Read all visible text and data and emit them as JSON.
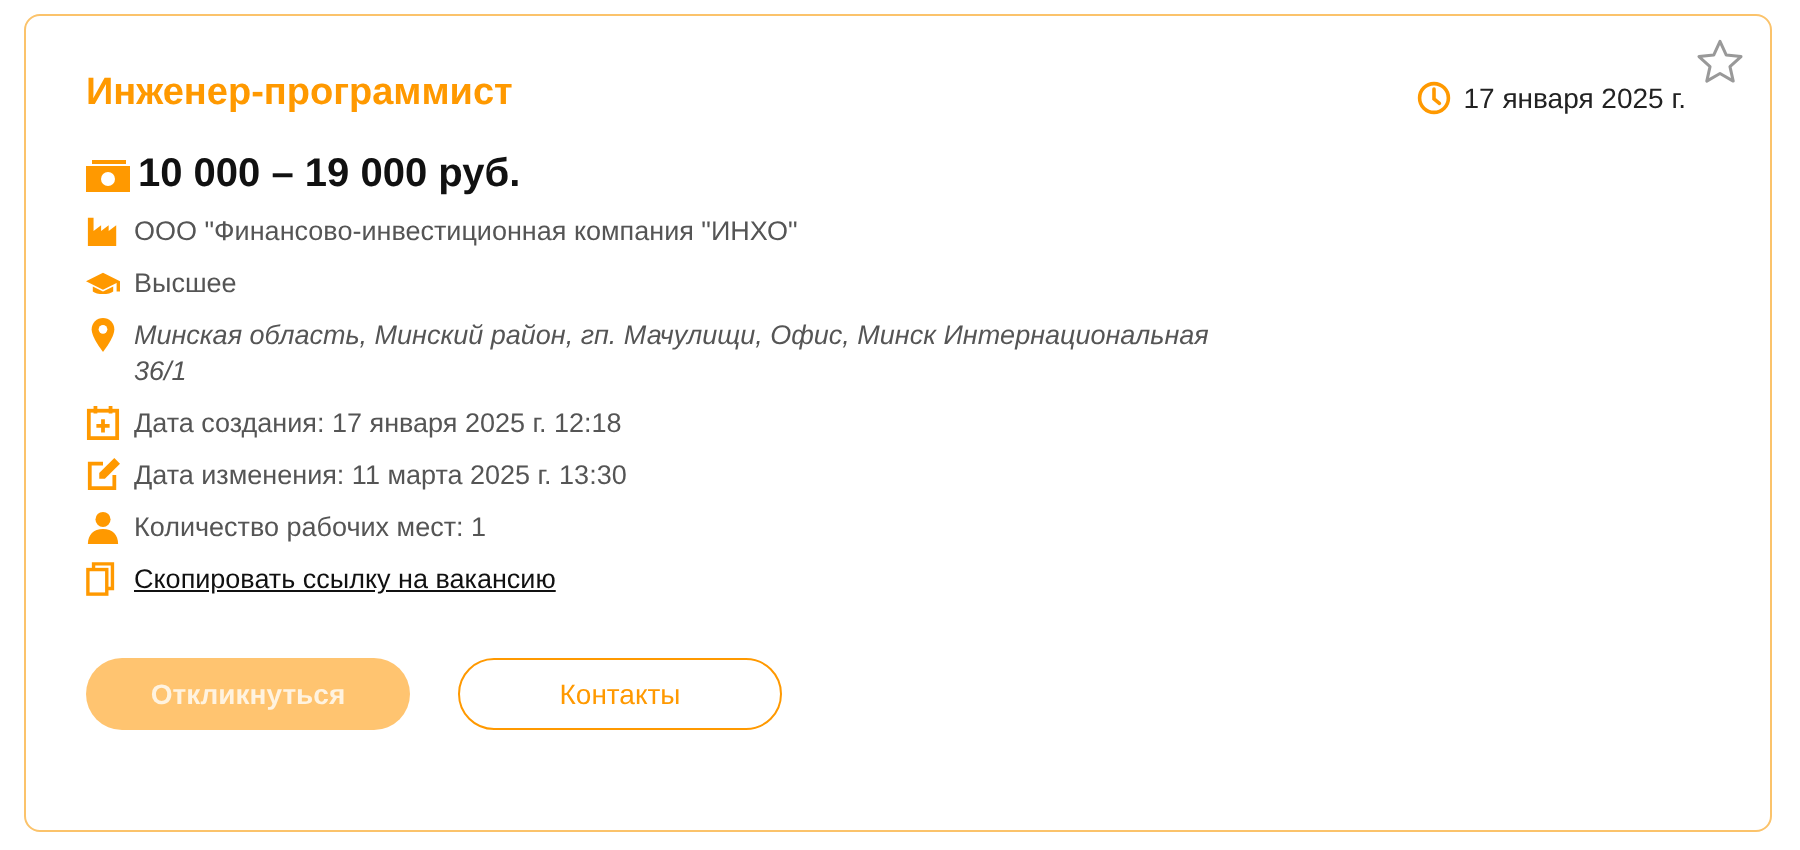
{
  "vacancy": {
    "title": "Инженер-программист",
    "date": "17 января 2025 г.",
    "favorite": false,
    "salary": "10 000 – 19 000 руб.",
    "details": [
      {
        "kind": "company",
        "text": "ООО \"Финансово-инвестиционная компания \"ИНХО\""
      },
      {
        "kind": "education",
        "text": "Высшее"
      },
      {
        "kind": "address",
        "text": "Минская область, Минский район, гп. Мачулищи, Офис, Минск Интернациональная 36/1"
      },
      {
        "kind": "created",
        "text": "Дата создания: 17 января 2025 г. 12:18"
      },
      {
        "kind": "modified",
        "text": "Дата изменения: 11 марта 2025 г. 13:30"
      },
      {
        "kind": "workplaces",
        "text": "Количество рабочих мест: 1"
      },
      {
        "kind": "copy-link",
        "text": "Скопировать ссылку на вакансию"
      }
    ],
    "buttons": [
      {
        "kind": "primary",
        "label": "Откликнуться",
        "disabled": true
      },
      {
        "kind": "outline",
        "label": "Контакты",
        "disabled": false
      }
    ]
  }
}
